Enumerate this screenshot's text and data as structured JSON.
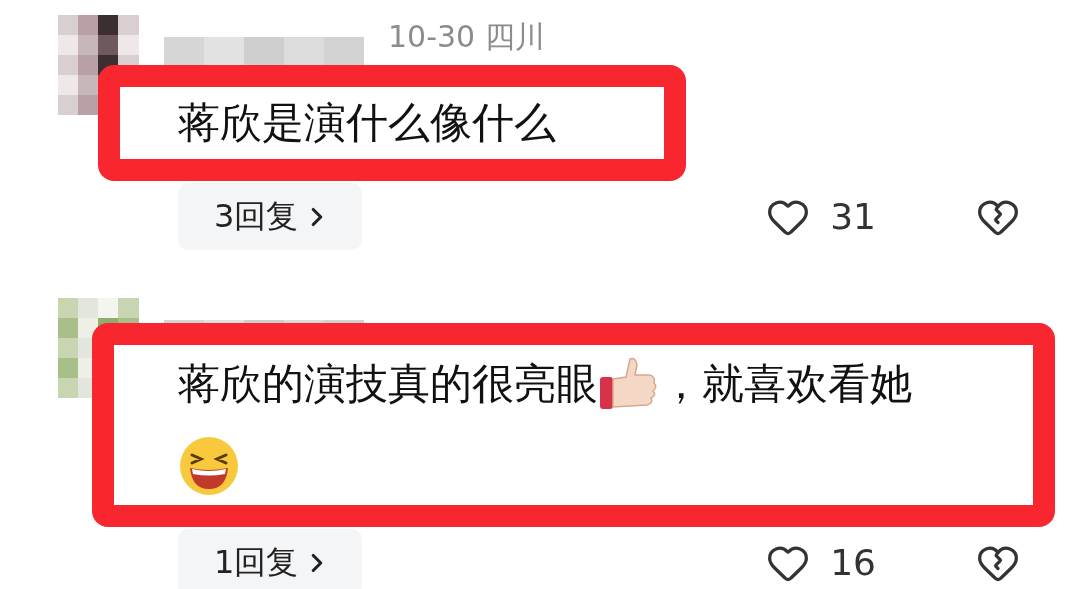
{
  "comments": [
    {
      "date_region": "10-30  四川",
      "segments": [
        {
          "kind": "text",
          "text": "蒋欣是演什么像什么"
        }
      ],
      "highlighted": true,
      "replies": "3回复",
      "liked": false,
      "likes": "31"
    },
    {
      "segments": [
        {
          "kind": "text",
          "text": "蒋欣的演技真的很亮眼"
        },
        {
          "kind": "thumbs_up"
        },
        {
          "kind": "text",
          "text": "，就喜欢看她"
        },
        {
          "kind": "break"
        },
        {
          "kind": "laughing"
        }
      ],
      "highlighted": true,
      "replies": "1回复",
      "liked": false,
      "likes": "16"
    }
  ]
}
